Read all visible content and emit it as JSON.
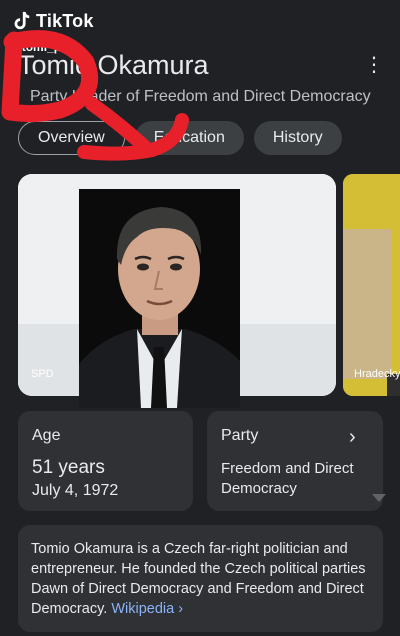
{
  "watermark": {
    "brand": "TikTok",
    "handle": "@tomi_paci_"
  },
  "knowledge_panel": {
    "title": "Tomio Okamura",
    "subtitle": "Party Leader of Freedom and Direct Democracy",
    "tabs": [
      {
        "label": "Overview",
        "active": true
      },
      {
        "label": "Education",
        "active": false
      },
      {
        "label": "History",
        "active": false
      }
    ],
    "images": [
      {
        "caption": "SPD"
      },
      {
        "caption": "Hradecky"
      }
    ],
    "age": {
      "label": "Age",
      "value": "51 years",
      "birth_date": "July 4, 1972"
    },
    "party": {
      "label": "Party",
      "value": "Freedom and Direct Democracy"
    },
    "description": {
      "text": "Tomio Okamura is a Czech far-right politician and entrepreneur. He founded the Czech political parties Dawn of Direct Democracy and Freedom and Direct Democracy.",
      "source_link": "Wikipedia ›"
    }
  },
  "colors": {
    "background": "#202124",
    "card": "#303134",
    "link": "#8ab4f8",
    "annotation_red": "#e8202a"
  },
  "icons": [
    "tiktok-logo-icon",
    "more-vert-icon",
    "chevron-right-icon"
  ]
}
